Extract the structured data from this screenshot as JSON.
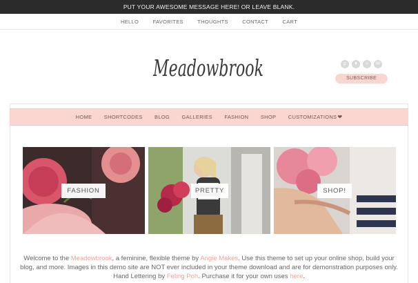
{
  "topbar": {
    "message": "PUT YOUR AWESOME MESSAGE HERE! OR LEAVE BLANK."
  },
  "top_nav": {
    "items": [
      "HELLO",
      "FAVORITES",
      "THOUGHTS",
      "CONTACT",
      "CART"
    ]
  },
  "header": {
    "logo_text": "Meadowbrook",
    "subscribe_label": "SUBSCRIBE",
    "social_icons": [
      "pinterest-icon",
      "heart-icon",
      "rss-icon",
      "mail-icon"
    ]
  },
  "main_nav": {
    "items": [
      "HOME",
      "SHORTCODES",
      "BLOG",
      "GALLERIES",
      "FASHION",
      "SHOP"
    ],
    "customizations_label": "CUSTOMIZATIONS"
  },
  "tiles": [
    {
      "label": "FASHION"
    },
    {
      "label": "PRETTY"
    },
    {
      "label": "SHOP!"
    }
  ],
  "welcome": {
    "t1": "Welcome to the ",
    "l1": "Meadowbrook",
    "t2": ", a feminine, flexible theme by ",
    "l2": "Angie Makes",
    "t3": ". Use this theme to set up your online shop, build your blog, and more. Images in this demo site are NOT ever included in your theme download and are for demonstration purposes only. Hand Lettering by ",
    "l3": "Feling Poh",
    "t4": ". Purchase it for your own uses ",
    "l4": "here",
    "t5": "."
  },
  "colors": {
    "accent_pink": "#fbd5cf",
    "link": "#e9a79c",
    "topbar_bg": "#2b2b2b"
  }
}
